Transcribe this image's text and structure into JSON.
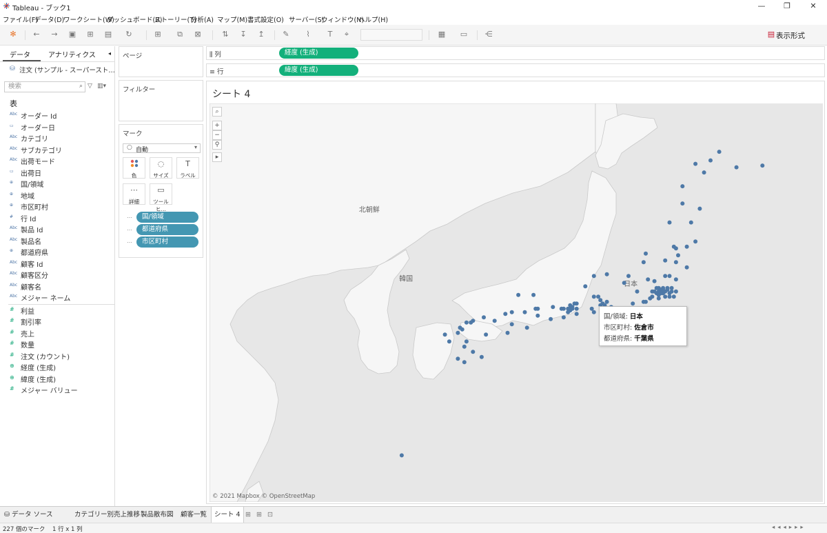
{
  "window": {
    "title": "Tableau - ブック1",
    "minimize": "—",
    "restore": "❐",
    "close": "✕"
  },
  "menu": [
    "ファイル(F)",
    "データ(D)",
    "ワークシート(W)",
    "ダッシュボード(B)",
    "ストーリー(T)",
    "分析(A)",
    "マップ(M)",
    "書式設定(O)",
    "サーバー(S)",
    "ウィンドウ(N)",
    "ヘルプ(H)"
  ],
  "toolbar": {
    "show_me": "表示形式"
  },
  "data_pane": {
    "tabs": [
      "データ",
      "アナリティクス"
    ],
    "source": "注文 (サンプル - スーパースト…",
    "search_placeholder": "検索",
    "section": "表",
    "dimensions": [
      {
        "icon": "Abc",
        "name": "オーダー Id"
      },
      {
        "icon": "▭",
        "name": "オーダー日"
      },
      {
        "icon": "Abc",
        "name": "カテゴリ"
      },
      {
        "icon": "Abc",
        "name": "サブカテゴリ"
      },
      {
        "icon": "Abc",
        "name": "出荷モード"
      },
      {
        "icon": "▭",
        "name": "出荷日"
      },
      {
        "icon": "⊕",
        "name": "国/領域"
      },
      {
        "icon": "⊕",
        "name": "地域"
      },
      {
        "icon": "⊕",
        "name": "市区町村"
      },
      {
        "icon": "#",
        "name": "行 Id"
      },
      {
        "icon": "Abc",
        "name": "製品 Id"
      },
      {
        "icon": "Abc",
        "name": "製品名"
      },
      {
        "icon": "⊕",
        "name": "都道府県"
      },
      {
        "icon": "Abc",
        "name": "顧客 Id"
      },
      {
        "icon": "Abc",
        "name": "顧客区分"
      },
      {
        "icon": "Abc",
        "name": "顧客名"
      },
      {
        "icon": "Abc",
        "name": "メジャー ネーム"
      }
    ],
    "measures": [
      {
        "icon": "#",
        "name": "利益"
      },
      {
        "icon": "#",
        "name": "割引率"
      },
      {
        "icon": "#",
        "name": "売上"
      },
      {
        "icon": "#",
        "name": "数量"
      },
      {
        "icon": "#",
        "name": "注文 (カウント)"
      },
      {
        "icon": "⊕",
        "name": "経度 (生成)"
      },
      {
        "icon": "⊕",
        "name": "緯度 (生成)"
      },
      {
        "icon": "#",
        "name": "メジャー バリュー"
      }
    ]
  },
  "pages_card": {
    "title": "ページ"
  },
  "filters_card": {
    "title": "フィルター"
  },
  "marks_card": {
    "title": "マーク",
    "type": "自動",
    "buttons": [
      {
        "glyph": "●",
        "label": "色"
      },
      {
        "glyph": "◌",
        "label": "サイズ"
      },
      {
        "glyph": "T",
        "label": "ラベル"
      },
      {
        "glyph": "⋯",
        "label": "詳細"
      },
      {
        "glyph": "▭",
        "label": "ツールヒ…"
      }
    ],
    "pills": [
      "国/領域",
      "都道府県",
      "市区町村"
    ]
  },
  "shelves": {
    "columns": {
      "label": "列",
      "pill": "経度 (生成)"
    },
    "rows": {
      "label": "行",
      "pill": "緯度 (生成)"
    }
  },
  "sheet": {
    "title": "シート 4"
  },
  "map": {
    "labels": [
      {
        "text": "北朝鮮",
        "lon": 126.2,
        "lat": 40.3
      },
      {
        "text": "韓国",
        "lon": 127.9,
        "lat": 36.3
      },
      {
        "text": "日本",
        "lon": 138.3,
        "lat": 36.0
      }
    ],
    "attribution": "© 2021 Mapbox © OpenStreetMap",
    "mark_color": "#4e79a7",
    "tooltip": {
      "rows": [
        {
          "label": "国/領域:",
          "value": "日本"
        },
        {
          "label": "市区町村:",
          "value": "佐倉市"
        },
        {
          "label": "都道府県:",
          "value": "千葉県"
        }
      ]
    }
  },
  "sheet_tabs": [
    "データ ソース",
    "カテゴリー別売上推移",
    "製品散布図",
    "顧客一覧",
    "シート 4"
  ],
  "status": {
    "marks": "227 個のマーク",
    "rows_cols": "1 行 x 1 列"
  }
}
